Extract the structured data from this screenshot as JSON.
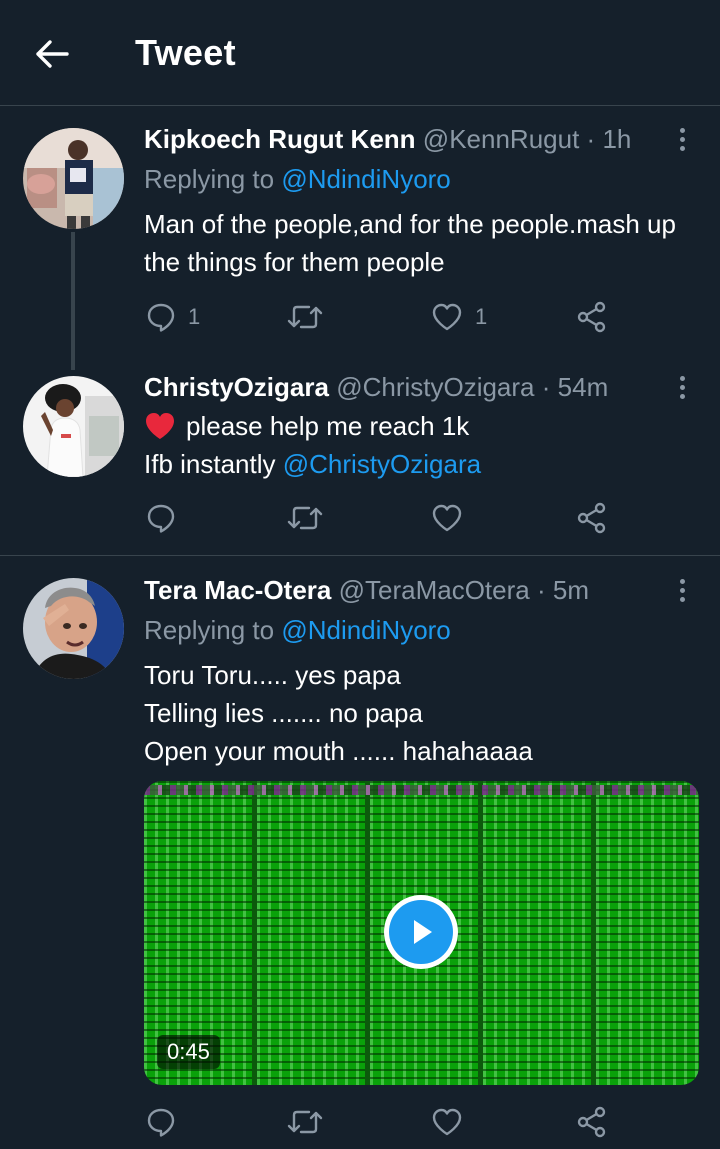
{
  "header": {
    "title": "Tweet",
    "back_icon": "arrow-left-icon"
  },
  "colors": {
    "background": "#15202b",
    "accent": "#1d9bf0",
    "muted": "#8b98a5",
    "divider": "#38444d",
    "like_heart": "#f91880"
  },
  "tweets": [
    {
      "name": "Kipkoech Rugut Kenn",
      "handle": "@KennRugut",
      "dot": "·",
      "time": "1h",
      "replying_prefix": "Replying to",
      "replying_to": "@NdindiNyoro",
      "body": "Man of the people,and for the people.mash up the things for them people",
      "replies": "1",
      "retweets": "",
      "likes": "1"
    },
    {
      "name": "ChristyOzigara",
      "handle": "@ChristyOzigara",
      "dot": "·",
      "time": "54m",
      "body_line1": "please help me reach 1k",
      "body_line2_prefix": "Ifb instantly",
      "body_line2_mention": "@ChristyOzigara",
      "replies": "",
      "retweets": "",
      "likes": ""
    },
    {
      "name": "Tera Mac-Otera",
      "handle": "@TeraMacOtera",
      "dot": "·",
      "time": "5m",
      "replying_prefix": "Replying to",
      "replying_to": "@NdindiNyoro",
      "body_lines": [
        "Toru Toru..... yes papa",
        "Telling lies ....... no papa",
        "Open your mouth ...... hahahaaaa"
      ],
      "video_duration": "0:45",
      "replies": "",
      "retweets": "",
      "likes": ""
    }
  ]
}
